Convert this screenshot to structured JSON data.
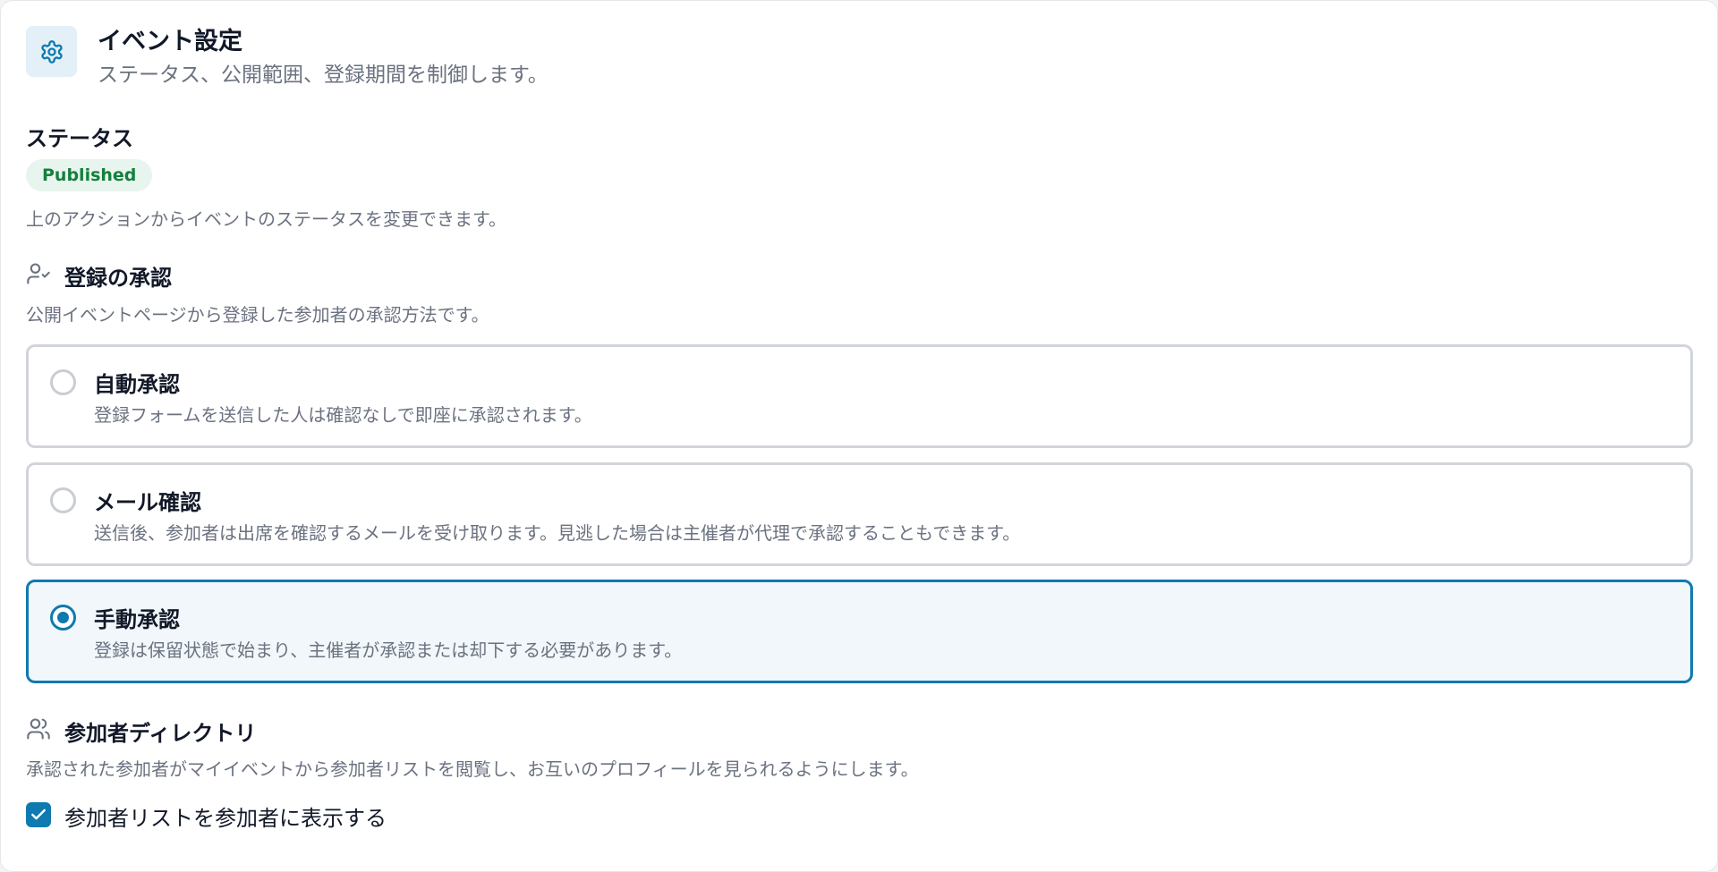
{
  "header": {
    "icon": "gear-icon",
    "title": "イベント設定",
    "subtitle": "ステータス、公開範囲、登録期間を制御します。"
  },
  "status": {
    "title": "ステータス",
    "badge": "Published",
    "hint": "上のアクションからイベントのステータスを変更できます。"
  },
  "approval": {
    "icon": "user-check-icon",
    "title": "登録の承認",
    "description": "公開イベントページから登録した参加者の承認方法です。",
    "options": [
      {
        "title": "自動承認",
        "description": "登録フォームを送信した人は確認なしで即座に承認されます。",
        "selected": false
      },
      {
        "title": "メール確認",
        "description": "送信後、参加者は出席を確認するメールを受け取ります。見逃した場合は主催者が代理で承認することもできます。",
        "selected": false
      },
      {
        "title": "手動承認",
        "description": "登録は保留状態で始まり、主催者が承認または却下する必要があります。",
        "selected": true
      }
    ]
  },
  "directory": {
    "icon": "users-icon",
    "title": "参加者ディレクトリ",
    "description": "承認された参加者がマイイベントから参加者リストを閲覧し、お互いのプロフィールを見られるようにします。",
    "checkbox_label": "参加者リストを参加者に表示する",
    "checked": true
  },
  "colors": {
    "accent": "#0e7ab0",
    "badge_bg": "#e8f5ee",
    "badge_text": "#15803d",
    "muted_text": "#6b7280"
  }
}
